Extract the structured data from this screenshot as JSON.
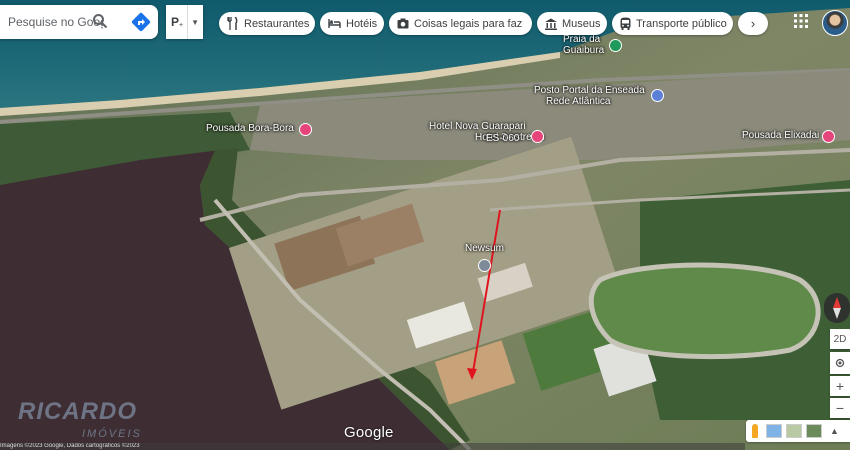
{
  "search": {
    "placeholder": "Pesquise no Google Maps"
  },
  "layers": {
    "label": "P"
  },
  "chips": [
    {
      "label": "Restaurantes",
      "icon": "restaurant-icon"
    },
    {
      "label": "Hotéis",
      "icon": "hotel-icon"
    },
    {
      "label": "Coisas legais para fazer",
      "icon": "camera-icon"
    },
    {
      "label": "Museus",
      "icon": "museum-icon"
    },
    {
      "label": "Transporte público",
      "icon": "transit-icon"
    }
  ],
  "chip_more": "›",
  "places": [
    {
      "name": "Praia da",
      "sub": "Guaibura",
      "pin": "green"
    },
    {
      "name": "Posto Portal da Enseada",
      "sub": "Rede Atlântica",
      "pin": "blue"
    },
    {
      "name": "Pousada Bora-Bora",
      "pin": "pink"
    },
    {
      "name": "Hotel Nova Guarapari",
      "sub": "Hotel 3 estrelas",
      "pin": "pink"
    },
    {
      "name": "Pousada Elixadai",
      "pin": "pink"
    },
    {
      "name": "Newsum",
      "pin": "grey"
    }
  ],
  "road_label": "ES-060",
  "map_controls": {
    "view_mode": "2D",
    "zoom_in": "+",
    "zoom_out": "−"
  },
  "google_logo": "Google",
  "watermark": {
    "line1": "RICARDO",
    "line2": "IMÓVEIS"
  },
  "attribution": "Imagens ©2023 Google, Dados cartográficos ©2023",
  "colors": {
    "pink_pin": "#e5457a",
    "blue_pin": "#5c7fd8",
    "green_pin": "#1f9a5a",
    "arrow": "#e0141e",
    "lagoon": "#3e2e33",
    "ocean": "#1c5f73"
  }
}
